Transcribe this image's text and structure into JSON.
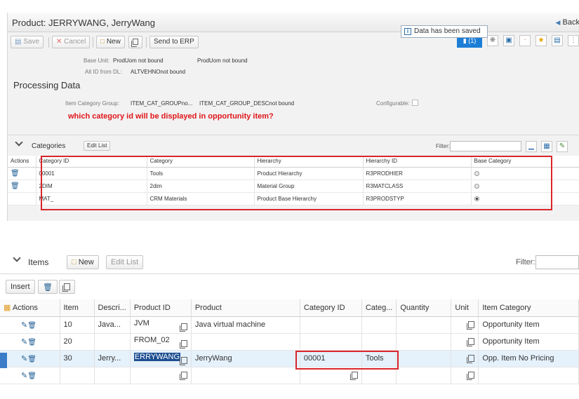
{
  "header": {
    "title": "Product: JERRYWANG, JerryWang",
    "back_label": "Back"
  },
  "toolbar": {
    "save_label": "Save",
    "cancel_label": "Cancel",
    "new_label": "New",
    "send_label": "Send to ERP",
    "messages_label": "(1)"
  },
  "toast": {
    "text": "Data has been saved"
  },
  "fields": {
    "base_unit_label": "Base Unit:",
    "base_unit_value1": "ProdUom not bound",
    "base_unit_value2": "ProdUom not bound",
    "alt_id_label": "Alt ID from DL:",
    "alt_id_value": "ALTVEHNOnot bound"
  },
  "processing": {
    "title": "Processing Data",
    "icg_label": "Item Category Group:",
    "icg_value1": "ITEM_CAT_GROUPno...",
    "icg_value2": "ITEM_CAT_GROUP_DESCnot bound",
    "configurable_label": "Configurable:"
  },
  "annotation": "which category id will be displayed in opportunity item?",
  "categories": {
    "title": "Categories",
    "edit_list": "Edit List",
    "filter_label": "Filter:",
    "columns": [
      "Actions",
      "Category ID",
      "Category",
      "Hierarchy",
      "Hierarchy ID",
      "Base Category"
    ],
    "rows": [
      {
        "has_delete": true,
        "id": "00001",
        "category": "Tools",
        "hierarchy": "Product Hierarchy",
        "hierarchy_id": "R3PRODHIER",
        "base": false
      },
      {
        "has_delete": true,
        "id": "2DIM",
        "category": "2dim",
        "hierarchy": "Material Group",
        "hierarchy_id": "R3MATCLASS",
        "base": false
      },
      {
        "has_delete": false,
        "id": "MAT_",
        "category": "CRM Materials",
        "hierarchy": "Product Base Hierarchy",
        "hierarchy_id": "R3PRODSTYP",
        "base": true
      }
    ]
  },
  "items": {
    "title": "Items",
    "new_label": "New",
    "edit_list": "Edit List",
    "filter_label": "Filter:",
    "insert_label": "Insert",
    "columns": [
      "Actions",
      "Item",
      "Descri...",
      "Product ID",
      "Product",
      "Category ID",
      "Categ...",
      "Quantity",
      "Unit",
      "Item Category"
    ],
    "rows": [
      {
        "item": "10",
        "descr": "Java...",
        "product_id": "JVM",
        "product": "Java virtual machine",
        "category_id": "",
        "categ": "",
        "quantity": "",
        "item_category": "Opportunity Item",
        "selected": false
      },
      {
        "item": "20",
        "descr": "",
        "product_id": "FROM_02",
        "product": "",
        "category_id": "",
        "categ": "",
        "quantity": "",
        "item_category": "Opportunity Item",
        "selected": false
      },
      {
        "item": "30",
        "descr": "Jerry...",
        "product_id": "ERRYWANG",
        "product": "JerryWang",
        "category_id": "00001",
        "categ": "Tools",
        "quantity": "",
        "item_category": "Opp. Item No Pricing",
        "selected": true
      },
      {
        "item": "",
        "descr": "",
        "product_id": "",
        "product": "",
        "category_id": "",
        "categ": "",
        "quantity": "",
        "item_category": "",
        "selected": false
      }
    ]
  },
  "colors": {
    "accent": "#1c7ed6",
    "highlight_red": "#d9262b",
    "annotation_red": "#e0161a",
    "link_blue": "#2a6bb5"
  }
}
